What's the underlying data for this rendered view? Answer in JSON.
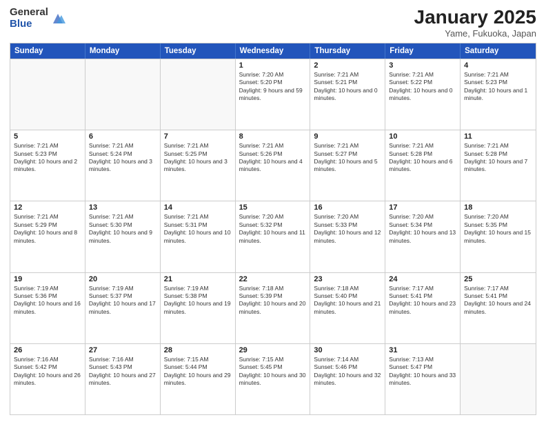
{
  "header": {
    "logo_general": "General",
    "logo_blue": "Blue",
    "month_title": "January 2025",
    "location": "Yame, Fukuoka, Japan"
  },
  "weekdays": [
    "Sunday",
    "Monday",
    "Tuesday",
    "Wednesday",
    "Thursday",
    "Friday",
    "Saturday"
  ],
  "rows": [
    [
      {
        "day": "",
        "text": ""
      },
      {
        "day": "",
        "text": ""
      },
      {
        "day": "",
        "text": ""
      },
      {
        "day": "1",
        "text": "Sunrise: 7:20 AM\nSunset: 5:20 PM\nDaylight: 9 hours and 59 minutes."
      },
      {
        "day": "2",
        "text": "Sunrise: 7:21 AM\nSunset: 5:21 PM\nDaylight: 10 hours and 0 minutes."
      },
      {
        "day": "3",
        "text": "Sunrise: 7:21 AM\nSunset: 5:22 PM\nDaylight: 10 hours and 0 minutes."
      },
      {
        "day": "4",
        "text": "Sunrise: 7:21 AM\nSunset: 5:23 PM\nDaylight: 10 hours and 1 minute."
      }
    ],
    [
      {
        "day": "5",
        "text": "Sunrise: 7:21 AM\nSunset: 5:23 PM\nDaylight: 10 hours and 2 minutes."
      },
      {
        "day": "6",
        "text": "Sunrise: 7:21 AM\nSunset: 5:24 PM\nDaylight: 10 hours and 3 minutes."
      },
      {
        "day": "7",
        "text": "Sunrise: 7:21 AM\nSunset: 5:25 PM\nDaylight: 10 hours and 3 minutes."
      },
      {
        "day": "8",
        "text": "Sunrise: 7:21 AM\nSunset: 5:26 PM\nDaylight: 10 hours and 4 minutes."
      },
      {
        "day": "9",
        "text": "Sunrise: 7:21 AM\nSunset: 5:27 PM\nDaylight: 10 hours and 5 minutes."
      },
      {
        "day": "10",
        "text": "Sunrise: 7:21 AM\nSunset: 5:28 PM\nDaylight: 10 hours and 6 minutes."
      },
      {
        "day": "11",
        "text": "Sunrise: 7:21 AM\nSunset: 5:28 PM\nDaylight: 10 hours and 7 minutes."
      }
    ],
    [
      {
        "day": "12",
        "text": "Sunrise: 7:21 AM\nSunset: 5:29 PM\nDaylight: 10 hours and 8 minutes."
      },
      {
        "day": "13",
        "text": "Sunrise: 7:21 AM\nSunset: 5:30 PM\nDaylight: 10 hours and 9 minutes."
      },
      {
        "day": "14",
        "text": "Sunrise: 7:21 AM\nSunset: 5:31 PM\nDaylight: 10 hours and 10 minutes."
      },
      {
        "day": "15",
        "text": "Sunrise: 7:20 AM\nSunset: 5:32 PM\nDaylight: 10 hours and 11 minutes."
      },
      {
        "day": "16",
        "text": "Sunrise: 7:20 AM\nSunset: 5:33 PM\nDaylight: 10 hours and 12 minutes."
      },
      {
        "day": "17",
        "text": "Sunrise: 7:20 AM\nSunset: 5:34 PM\nDaylight: 10 hours and 13 minutes."
      },
      {
        "day": "18",
        "text": "Sunrise: 7:20 AM\nSunset: 5:35 PM\nDaylight: 10 hours and 15 minutes."
      }
    ],
    [
      {
        "day": "19",
        "text": "Sunrise: 7:19 AM\nSunset: 5:36 PM\nDaylight: 10 hours and 16 minutes."
      },
      {
        "day": "20",
        "text": "Sunrise: 7:19 AM\nSunset: 5:37 PM\nDaylight: 10 hours and 17 minutes."
      },
      {
        "day": "21",
        "text": "Sunrise: 7:19 AM\nSunset: 5:38 PM\nDaylight: 10 hours and 19 minutes."
      },
      {
        "day": "22",
        "text": "Sunrise: 7:18 AM\nSunset: 5:39 PM\nDaylight: 10 hours and 20 minutes."
      },
      {
        "day": "23",
        "text": "Sunrise: 7:18 AM\nSunset: 5:40 PM\nDaylight: 10 hours and 21 minutes."
      },
      {
        "day": "24",
        "text": "Sunrise: 7:17 AM\nSunset: 5:41 PM\nDaylight: 10 hours and 23 minutes."
      },
      {
        "day": "25",
        "text": "Sunrise: 7:17 AM\nSunset: 5:41 PM\nDaylight: 10 hours and 24 minutes."
      }
    ],
    [
      {
        "day": "26",
        "text": "Sunrise: 7:16 AM\nSunset: 5:42 PM\nDaylight: 10 hours and 26 minutes."
      },
      {
        "day": "27",
        "text": "Sunrise: 7:16 AM\nSunset: 5:43 PM\nDaylight: 10 hours and 27 minutes."
      },
      {
        "day": "28",
        "text": "Sunrise: 7:15 AM\nSunset: 5:44 PM\nDaylight: 10 hours and 29 minutes."
      },
      {
        "day": "29",
        "text": "Sunrise: 7:15 AM\nSunset: 5:45 PM\nDaylight: 10 hours and 30 minutes."
      },
      {
        "day": "30",
        "text": "Sunrise: 7:14 AM\nSunset: 5:46 PM\nDaylight: 10 hours and 32 minutes."
      },
      {
        "day": "31",
        "text": "Sunrise: 7:13 AM\nSunset: 5:47 PM\nDaylight: 10 hours and 33 minutes."
      },
      {
        "day": "",
        "text": ""
      }
    ]
  ]
}
